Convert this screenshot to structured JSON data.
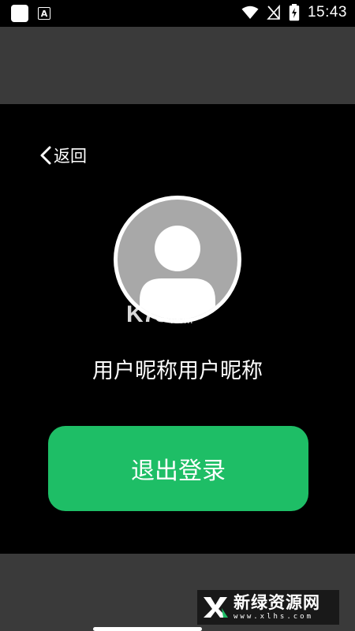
{
  "status_bar": {
    "time": "15:43",
    "left_icons": [
      "app-square-icon",
      "a-badge-icon"
    ],
    "a_badge_letter": "A",
    "right_icons": [
      "wifi-icon",
      "no-signal-icon",
      "battery-charging-icon"
    ]
  },
  "dialog": {
    "back_label": "返回",
    "nickname": "用户昵称用户昵称",
    "logout_label": "退出登录",
    "accent_color": "#1ebe66"
  },
  "watermarks": {
    "k73_big": "K73",
    "k73_cn": "游戏之家",
    "k73_com": ".com",
    "brand_cn": "新绿资源网",
    "brand_url": "www.xlhs.com"
  }
}
